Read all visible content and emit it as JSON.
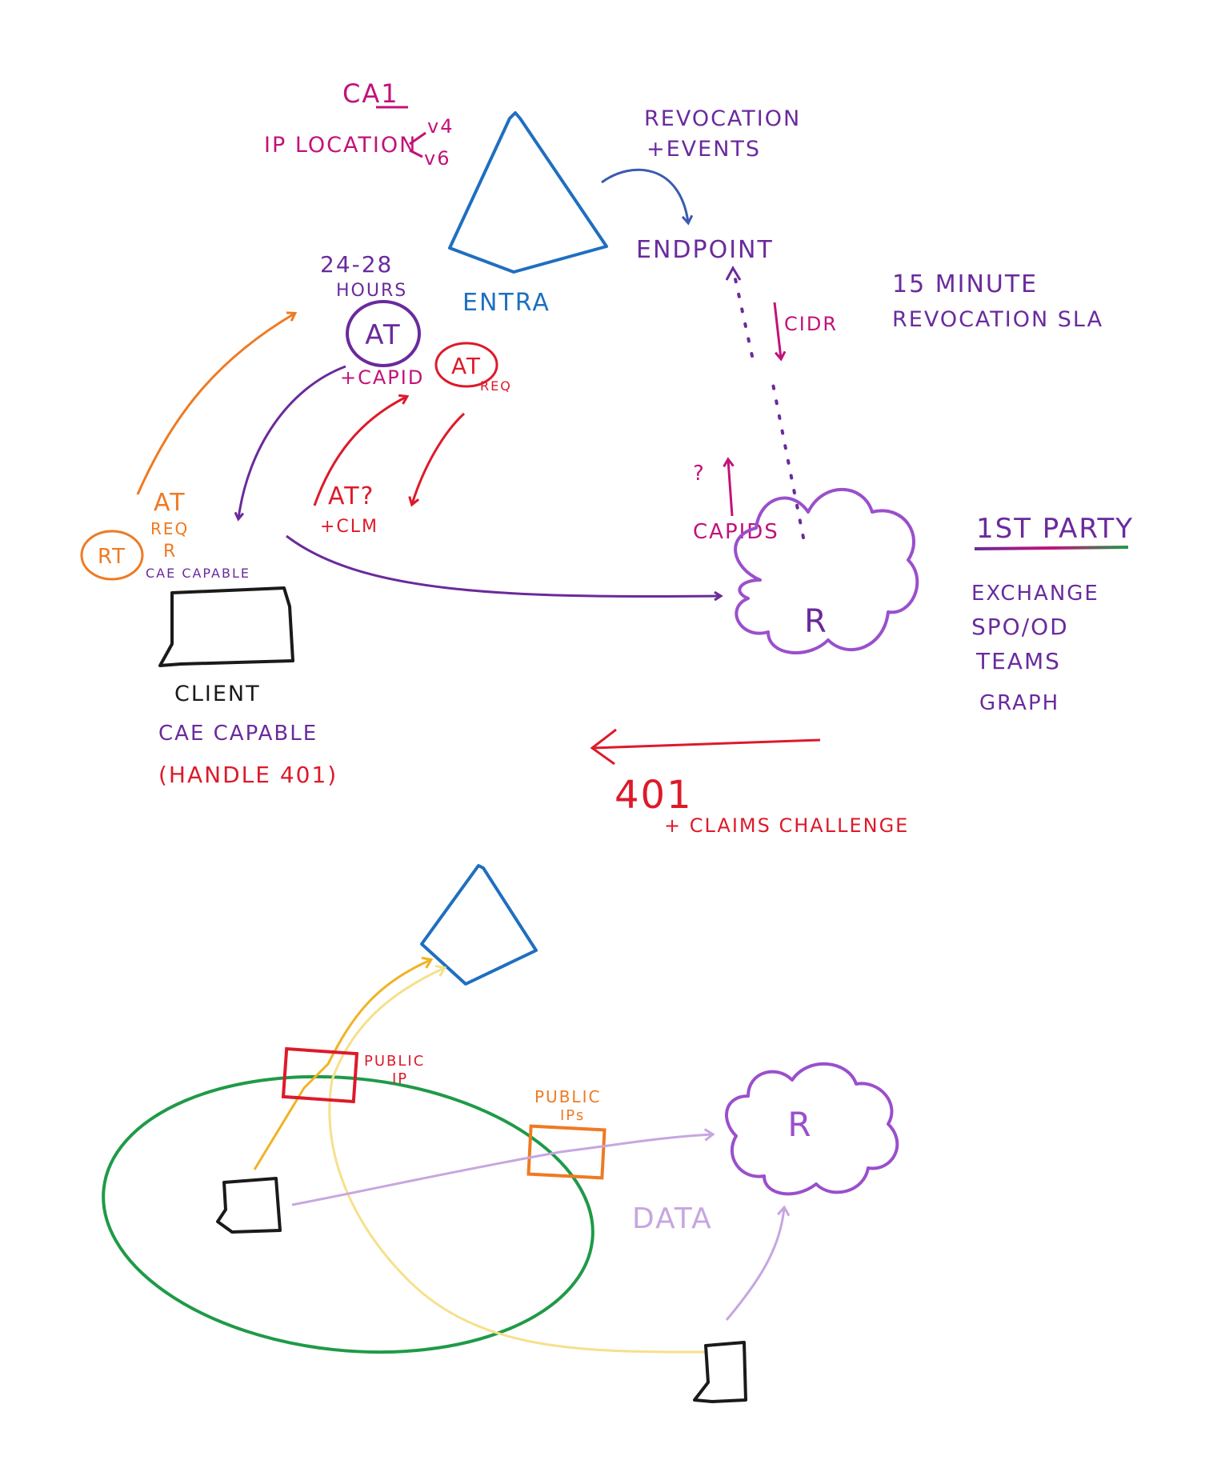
{
  "colors": {
    "magenta": "#c2127a",
    "blue": "#1f6fc0",
    "purple": "#6a2a9c",
    "orange": "#ef7a22",
    "red": "#dd1a2a",
    "black": "#1a1a1a",
    "green": "#1f9a48",
    "yellow": "#f0b323",
    "pale_yellow": "#f6e08a",
    "lavender": "#c7a6e0",
    "cloud_purple": "#9a4fcc"
  },
  "top": {
    "ca_title": "CA1",
    "ip_location": "IP LOCATION",
    "v4": "v4",
    "v6": "v6",
    "entra_label": "ENTRA",
    "revocation_events_line1": "REVOCATION",
    "revocation_events_line2": "+EVENTS",
    "endpoint_label": "ENDPOINT",
    "sla_line1": "15 MINUTE",
    "sla_line2": "REVOCATION SLA",
    "cidr_label": "CIDR",
    "hours_line1": "24-28",
    "hours_line2": "HOURS",
    "at_token": "AT",
    "capid": "+CAPID",
    "at_req_token": "AT",
    "at_req_label": "REQ",
    "rt_token": "RT",
    "at_req_side_line1": "AT",
    "at_req_side_line2": "REQ",
    "at_req_side_line3": "R",
    "cae_capable_small": "CAE CAPABLE",
    "at_question": "AT?",
    "claim": "+CLM",
    "question_mark": "?",
    "capids": "CAPIDS",
    "resource_label": "R",
    "client_label": "CLIENT",
    "cae_capable": "CAE CAPABLE",
    "handle_401": "(HANDLE 401)",
    "status_401": "401",
    "claims_challenge": "+ CLAIMS CHALLENGE",
    "first_party_title": "1ST PARTY",
    "first_party_items": [
      "EXCHANGE",
      "SPO/OD",
      "TEAMS",
      "GRAPH"
    ]
  },
  "bottom": {
    "public_ip": "PUBLIC",
    "public_ip_2": "IP",
    "public_ips": "PUBLIC",
    "public_ips_2": "IPs",
    "data_label": "DATA",
    "resource_label": "R"
  }
}
